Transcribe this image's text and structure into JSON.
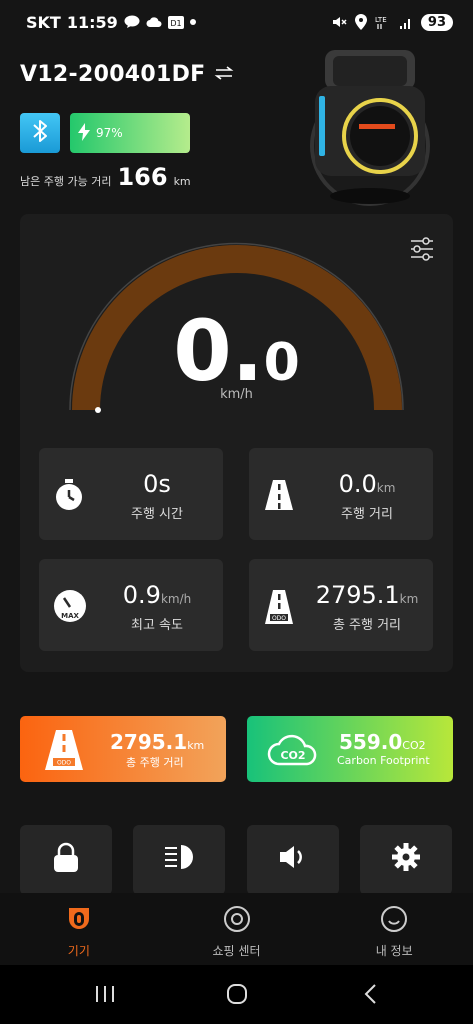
{
  "status_bar": {
    "carrier": "SKT",
    "time": "11:59",
    "battery": "93"
  },
  "device": {
    "title": "V12-200401DF",
    "battery_percent": "97%",
    "battery_level": 0.97,
    "range_label": "남은 주행 가능 거리",
    "range_value": "166",
    "range_unit": "km"
  },
  "speedometer": {
    "speed_int": "0.",
    "speed_dec": "0",
    "unit": "km/h",
    "arc_color": "#6b3a0f"
  },
  "stats": [
    {
      "value": "0s",
      "unit": "",
      "label": "주행 시간",
      "icon": "stopwatch-icon"
    },
    {
      "value": "0.0",
      "unit": "km",
      "label": "주행 거리",
      "icon": "road-icon"
    },
    {
      "value": "0.9",
      "unit": "km/h",
      "label": "최고 속도",
      "icon": "gauge-max-icon"
    },
    {
      "value": "2795.1",
      "unit": "km",
      "label": "총 주행 거리",
      "icon": "odometer-road-icon"
    }
  ],
  "promo": {
    "total": {
      "value": "2795.1",
      "unit": "km",
      "label": "총 주행 거리",
      "color": "#f36b1f"
    },
    "carbon": {
      "value": "559.0",
      "unit": "CO2",
      "label": "Carbon Footprint",
      "color": "#27c46c"
    }
  },
  "quick_actions": [
    {
      "icon": "lock-icon"
    },
    {
      "icon": "headlight-icon"
    },
    {
      "icon": "speaker-icon"
    },
    {
      "icon": "gear-icon",
      "label": "설정"
    }
  ],
  "tabs": [
    {
      "label": "기기",
      "icon": "device-icon",
      "active": true
    },
    {
      "label": "쇼핑 센터",
      "icon": "shop-icon",
      "active": false
    },
    {
      "label": "내 정보",
      "icon": "profile-icon",
      "active": false
    }
  ],
  "colors": {
    "accent": "#f06a1c",
    "panel": "#1d1d1d",
    "card": "#2b2b2b"
  }
}
